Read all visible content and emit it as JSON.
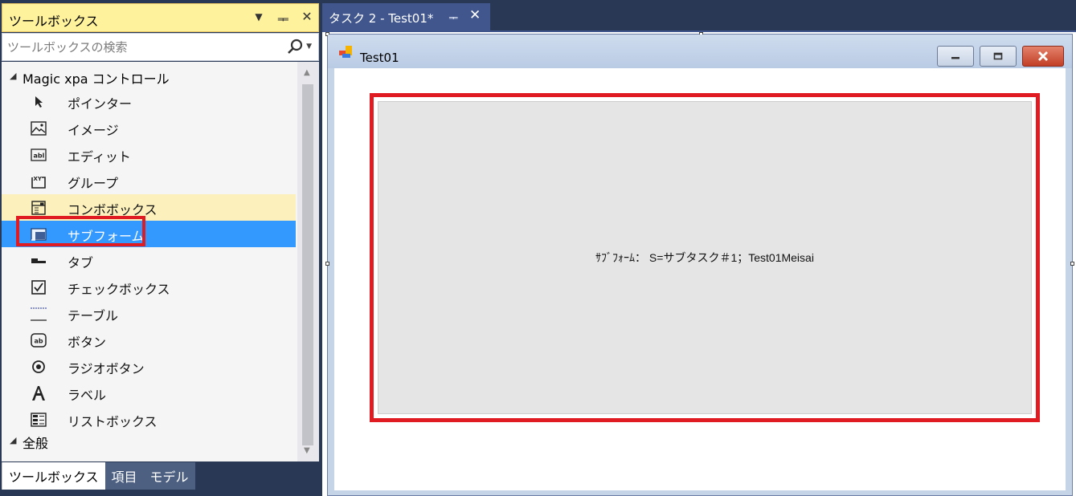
{
  "toolbox": {
    "title": "ツールボックス",
    "title_buttons": {
      "dropdown": "▼",
      "pin": "ᆍ",
      "close": "✕"
    },
    "search_placeholder": "ツールボックスの検索",
    "groups": [
      {
        "label": "Magic xpa コントロール",
        "expanded": true
      },
      {
        "label": "全般",
        "expanded": true
      }
    ],
    "items": [
      {
        "label": "ポインター",
        "icon": "pointer-icon"
      },
      {
        "label": "イメージ",
        "icon": "image-icon"
      },
      {
        "label": "エディット",
        "icon": "edit-icon"
      },
      {
        "label": "グループ",
        "icon": "group-icon"
      },
      {
        "label": "コンボボックス",
        "icon": "combobox-icon",
        "state": "hover"
      },
      {
        "label": "サブフォーム",
        "icon": "subform-icon",
        "state": "selected"
      },
      {
        "label": "タブ",
        "icon": "tab-icon"
      },
      {
        "label": "チェックボックス",
        "icon": "checkbox-icon"
      },
      {
        "label": "テーブル",
        "icon": "table-icon"
      },
      {
        "label": "ボタン",
        "icon": "button-icon"
      },
      {
        "label": "ラジオボタン",
        "icon": "radio-icon"
      },
      {
        "label": "ラベル",
        "icon": "label-icon"
      },
      {
        "label": "リストボックス",
        "icon": "listbox-icon"
      }
    ],
    "bottom_tabs": [
      {
        "label": "ツールボックス",
        "active": true
      },
      {
        "label": "項目",
        "active": false
      },
      {
        "label": "モデル",
        "active": false
      }
    ]
  },
  "document_tab": {
    "label": "タスク 2 - Test01*",
    "pin": "ᆍ",
    "close": "✕"
  },
  "form": {
    "title": "Test01",
    "subform_text": "ｻﾌﾞﾌｫｰﾑ： S=サブタスク＃1；Test01Meisai"
  },
  "colors": {
    "highlight_red": "#e01b22",
    "selection_blue": "#3399ff",
    "hover_yellow": "#fcf1bd",
    "frame_navy": "#293955"
  }
}
